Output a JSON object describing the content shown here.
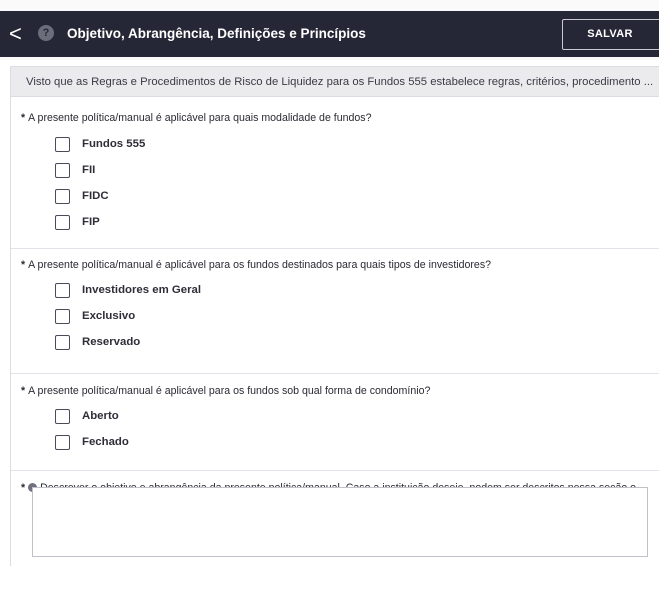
{
  "header": {
    "back_glyph": "<",
    "help_glyph": "?",
    "title": "Objetivo, Abrangência, Definições e Princípios",
    "save_label": "SALVAR"
  },
  "intro": {
    "text": "Visto que as Regras e Procedimentos de Risco de Liquidez para os Fundos 555 estabelece regras, critérios, procedimento ..."
  },
  "questions": [
    {
      "required_mark": "*",
      "text": "A presente política/manual é aplicável para quais modalidade de fundos?",
      "options": [
        "Fundos 555",
        "FII",
        "FIDC",
        "FIP"
      ]
    },
    {
      "required_mark": "*",
      "text": "A presente política/manual é aplicável para os fundos destinados para quais tipos de investidores?",
      "options": [
        "Investidores em Geral",
        "Exclusivo",
        "Reservado"
      ]
    },
    {
      "required_mark": "*",
      "text": "A presente política/manual é aplicável para os fundos sob qual forma de condomínio?",
      "options": [
        "Aberto",
        "Fechado"
      ]
    },
    {
      "required_mark": "*",
      "text": "Descrever o objetivo e abrangência da presente política/manual. Caso a instituição deseje, podem ser descritos nessa seção o...",
      "textarea_value": ""
    }
  ],
  "icons": {
    "back": "chevron-left-icon",
    "help": "help-circle-icon",
    "question_info": "info-circle-icon"
  },
  "colors": {
    "header_bg": "#262736",
    "intro_bg": "#ebebee",
    "text": "#2a2a33"
  }
}
